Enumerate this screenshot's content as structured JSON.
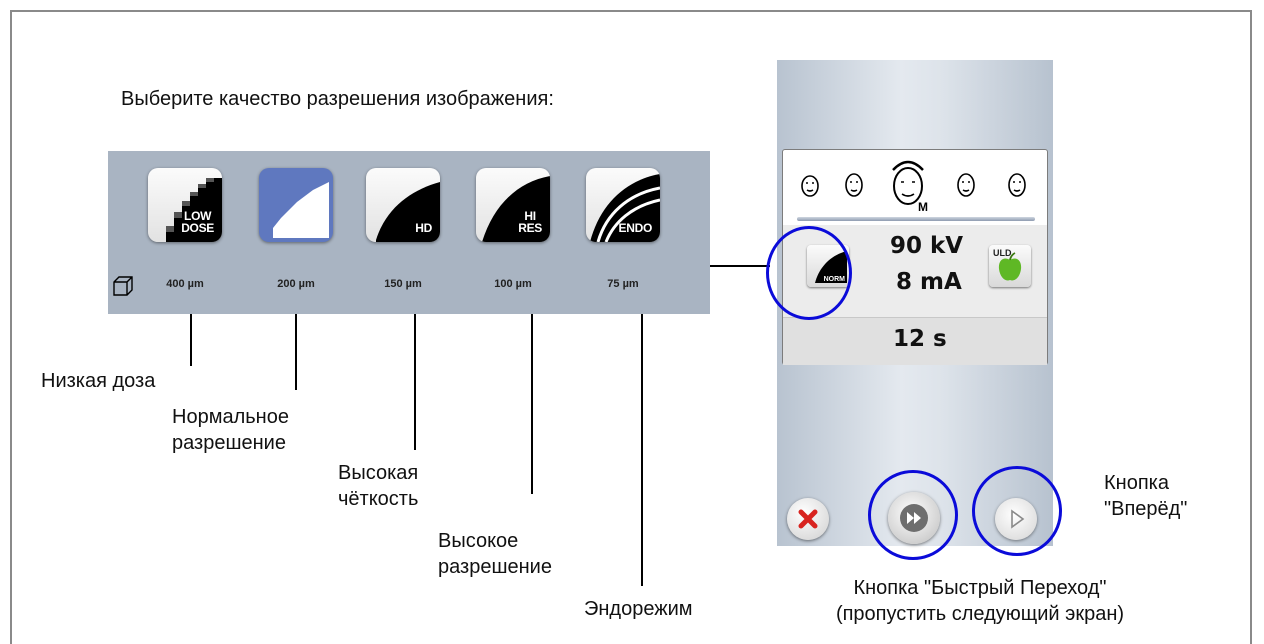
{
  "heading": "Выберите качество разрешения изображения:",
  "quality_buttons": [
    {
      "id": "low-dose",
      "label_line1": "LOW",
      "label_line2": "DOSE",
      "size": "400 µm",
      "caption_lines": [
        "Низкая доза"
      ],
      "selected": false
    },
    {
      "id": "norm",
      "label_line1": "NORM",
      "label_line2": "",
      "size": "200 µm",
      "caption_lines": [
        "Нормальное",
        "разрешение"
      ],
      "selected": true
    },
    {
      "id": "hd",
      "label_line1": "HD",
      "label_line2": "",
      "size": "150 µm",
      "caption_lines": [
        "Высокая",
        "чёткость"
      ],
      "selected": false
    },
    {
      "id": "hi-res",
      "label_line1": "HI",
      "label_line2": "RES",
      "size": "100 µm",
      "caption_lines": [
        "Высокое",
        "разрешение"
      ],
      "selected": false
    },
    {
      "id": "endo",
      "label_line1": "ENDO",
      "label_line2": "",
      "size": "75 µm",
      "caption_lines": [
        "Эндорежим"
      ],
      "selected": false
    }
  ],
  "device": {
    "head_size_label": "M",
    "kv": "90 kV",
    "ma": "8 mA",
    "time": "12 s",
    "current_quality_label": "NORM",
    "uld_label": "ULD"
  },
  "callouts": {
    "forward_line1": "Кнопка",
    "forward_line2": "\"Вперёд\"",
    "fast_line1": "Кнопка \"Быстрый Переход\"",
    "fast_line2": "(пропустить следующий экран)"
  },
  "colors": {
    "panel_bg": "#a9b4c2",
    "selected_button": "#5f78bf",
    "highlight_ring": "#0b0bd9",
    "cancel_red": "#d8231f",
    "apple_green": "#5fb825"
  },
  "icons": [
    "cube-icon",
    "head-icon",
    "norm-quality-icon",
    "apple-icon",
    "cancel-icon",
    "fast-forward-icon",
    "next-icon"
  ]
}
